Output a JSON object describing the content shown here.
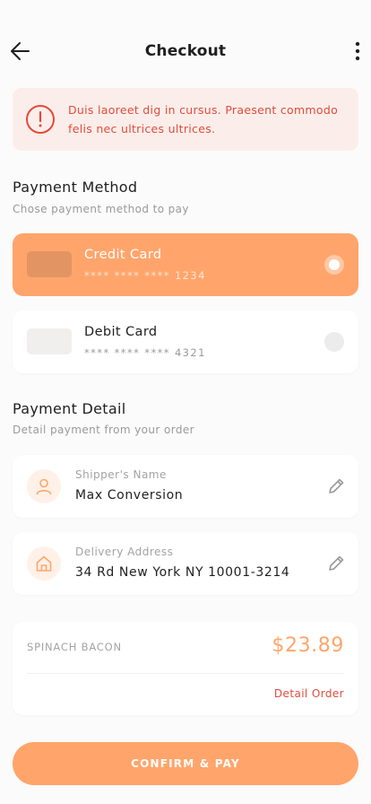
{
  "header": {
    "title": "Checkout",
    "back_icon": "arrow-left-icon",
    "more_icon": "more-vertical-icon"
  },
  "alert": {
    "icon": "alert-circle-icon",
    "message": "Duis laoreet dig in cursus. Praesent commodo felis nec ultrices ultrices."
  },
  "payment_method": {
    "title": "Payment Method",
    "subtitle": "Chose payment method to pay",
    "options": [
      {
        "name": "Credit Card",
        "number": "**** **** **** 1234",
        "selected": true
      },
      {
        "name": "Debit Card",
        "number": "**** **** **** 4321",
        "selected": false
      }
    ]
  },
  "payment_detail": {
    "title": "Payment Detail",
    "subtitle": "Detail payment from your order",
    "shipper": {
      "label": "Shipper's Name",
      "value": "Max Conversion",
      "icon": "user-icon"
    },
    "address": {
      "label": "Delivery Address",
      "value": "34 Rd New York NY 10001-3214",
      "icon": "home-icon"
    }
  },
  "order": {
    "item_name": "SPINACH BACON",
    "price": "$23.89",
    "detail_link": "Detail Order"
  },
  "confirm_label": "CONFIRM & PAY",
  "colors": {
    "accent": "#ffa56b",
    "alert_bg": "#fbeeea",
    "alert_text": "#e34a3b",
    "background": "#fbfbfb"
  }
}
